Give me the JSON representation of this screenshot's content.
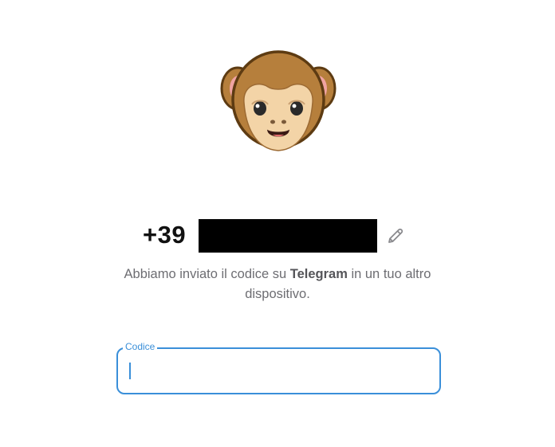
{
  "sticker": {
    "icon": "monkey-face-icon",
    "colors": {
      "fur": "#b67f3c",
      "outline": "#5d3b12",
      "face": "#f3d4a7",
      "ear_inner": "#f0a3a1"
    }
  },
  "phone": {
    "prefix": "+39",
    "number_redacted": true,
    "edit_icon": "pencil-icon"
  },
  "message": {
    "before": "Abbiamo inviato il codice su ",
    "bold": "Telegram",
    "after": " in un tuo altro dispositivo."
  },
  "code_field": {
    "label": "Codice",
    "value": "",
    "accent_color": "#3a8fd9"
  }
}
